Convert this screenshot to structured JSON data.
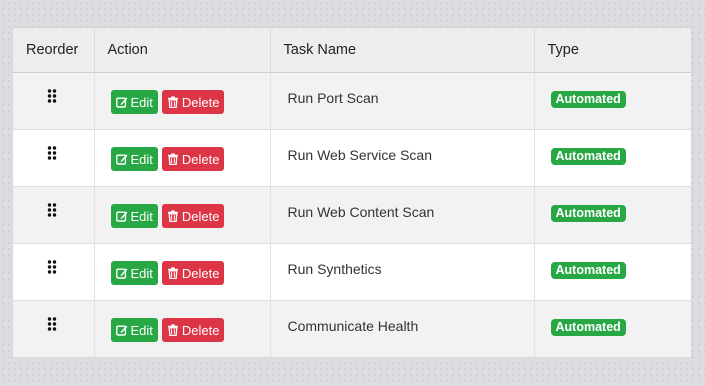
{
  "table": {
    "headers": [
      "Reorder",
      "Action",
      "Task Name",
      "Type"
    ],
    "rows": [
      {
        "task": "Run Port Scan",
        "type": "Automated"
      },
      {
        "task": "Run Web Service Scan",
        "type": "Automated"
      },
      {
        "task": "Run Web Content Scan",
        "type": "Automated"
      },
      {
        "task": "Run Synthetics",
        "type": "Automated"
      },
      {
        "task": "Communicate Health",
        "type": "Automated"
      }
    ],
    "edit_label": "Edit",
    "delete_label": "Delete"
  },
  "icons": {
    "reorder": "grip-vertical-icon",
    "edit": "edit-icon",
    "delete": "trash-icon"
  },
  "colors": {
    "edit_button": "#28a745",
    "delete_button": "#dc3545",
    "badge": "#28a745"
  }
}
